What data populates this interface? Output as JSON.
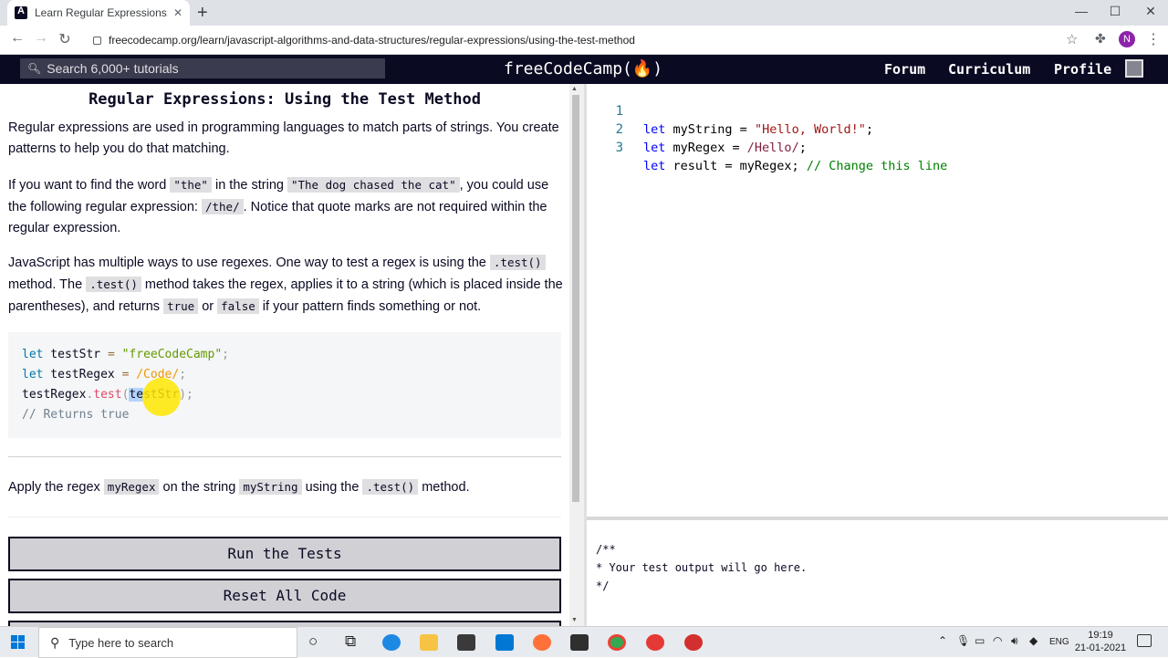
{
  "browser": {
    "tab_title": "Learn Regular Expressions: Using",
    "tab_close": "✕",
    "new_tab": "+",
    "url": "freecodecamp.org/learn/javascript-algorithms-and-data-structures/regular-expressions/using-the-test-method",
    "avatar_letter": "N",
    "minimize": "—",
    "maximize": "☐",
    "close": "✕"
  },
  "navbar": {
    "search_placeholder": "Search 6,000+ tutorials",
    "logo": "freeCodeCamp(🔥)",
    "links": [
      "Forum",
      "Curriculum",
      "Profile"
    ]
  },
  "challenge": {
    "title": "Regular Expressions: Using the Test Method",
    "p1": "Regular expressions are used in programming languages to match parts of strings. You create patterns to help you do that matching.",
    "p2": {
      "t1": "If you want to find the word ",
      "c1": "\"the\"",
      "t2": " in the string ",
      "c2": "\"The dog chased the cat\"",
      "t3": ", you could use the following regular expression: ",
      "c3": "/the/",
      "t4": ". Notice that quote marks are not required within the regular expression."
    },
    "p3": {
      "t1": "JavaScript has multiple ways to use regexes. One way to test a regex is using the ",
      "c1": ".test()",
      "t2": " method. The ",
      "c2": ".test()",
      "t3": " method takes the regex, applies it to a string (which is placed inside the parentheses), and returns ",
      "c3": "true",
      "t4": " or ",
      "c4": "false",
      "t5": " if your pattern finds something or not."
    },
    "example": {
      "l1": {
        "kw": "let",
        "name": " testStr ",
        "op": "=",
        "str": " \"freeCodeCamp\"",
        "pn": ";"
      },
      "l2": {
        "kw": "let",
        "name": " testRegex ",
        "op": "=",
        "rx": " /Code/",
        "pn": ";"
      },
      "l3": {
        "obj": "testRegex",
        "dot": ".",
        "fn": "test",
        "open": "(",
        "sel": "te",
        "rest": "stStr",
        "close": ");"
      },
      "l4": "// Returns true"
    },
    "instruction": {
      "t1": "Apply the regex ",
      "c1": "myRegex",
      "t2": " on the string ",
      "c2": "myString",
      "t3": " using the ",
      "c3": ".test()",
      "t4": " method."
    },
    "run_button": "Run the Tests",
    "reset_button": "Reset All Code"
  },
  "editor": {
    "lines": [
      {
        "num": "1",
        "kw": "let",
        "a": " myString = ",
        "str": "\"Hello, World!\"",
        "b": ";"
      },
      {
        "num": "2",
        "kw": "let",
        "a": " myRegex = ",
        "rx": "/Hello/",
        "b": ";"
      },
      {
        "num": "3",
        "kw": "let",
        "a": " result = myRegex; ",
        "cm": "// Change this line"
      }
    ]
  },
  "output": {
    "text": "/**\n* Your test output will go here.\n*/"
  },
  "taskbar": {
    "search_placeholder": "Type here to search",
    "lang": "ENG",
    "time": "19:19",
    "date": "21-01-2021"
  }
}
